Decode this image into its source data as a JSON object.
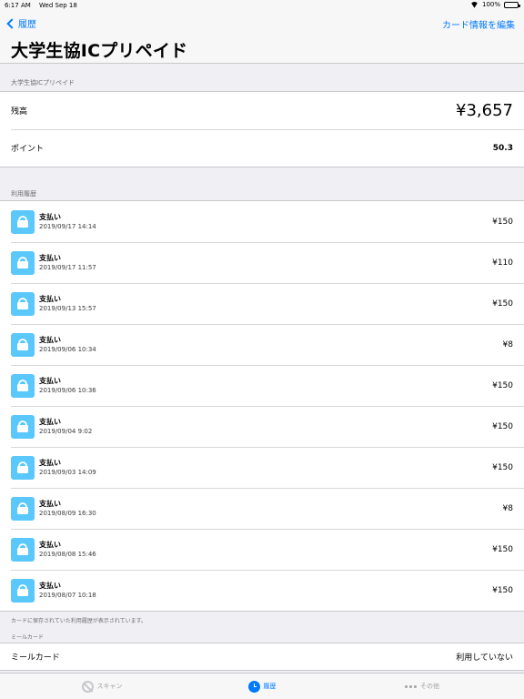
{
  "status_bar": {
    "time": "6:17 AM",
    "date": "Wed Sep 18",
    "battery": "100%"
  },
  "nav": {
    "back_label": "履歴",
    "edit_label": "カード情報を編集",
    "title": "大学生協ICプリペイド"
  },
  "card_section": {
    "header": "大学生協ICプリペイド",
    "balance_label": "残高",
    "balance_value": "¥3,657",
    "points_label": "ポイント",
    "points_value": "50.3"
  },
  "history": {
    "header": "利用履歴",
    "items": [
      {
        "title": "支払い",
        "date": "2019/09/17 14:14",
        "amount": "¥150"
      },
      {
        "title": "支払い",
        "date": "2019/09/17 11:57",
        "amount": "¥110"
      },
      {
        "title": "支払い",
        "date": "2019/09/13 15:57",
        "amount": "¥150"
      },
      {
        "title": "支払い",
        "date": "2019/09/06 10:34",
        "amount": "¥8"
      },
      {
        "title": "支払い",
        "date": "2019/09/06 10:36",
        "amount": "¥150"
      },
      {
        "title": "支払い",
        "date": "2019/09/04 9:02",
        "amount": "¥150"
      },
      {
        "title": "支払い",
        "date": "2019/09/03 14:09",
        "amount": "¥150"
      },
      {
        "title": "支払い",
        "date": "2019/08/09 16:30",
        "amount": "¥8"
      },
      {
        "title": "支払い",
        "date": "2019/08/08 15:46",
        "amount": "¥150"
      },
      {
        "title": "支払い",
        "date": "2019/08/07 10:18",
        "amount": "¥150"
      }
    ],
    "footer": "カードに保存されていた利用履歴が表示されています。"
  },
  "meal_card": {
    "header": "ミールカード",
    "label": "ミールカード",
    "status": "利用していない"
  },
  "tab_bar": {
    "scan_label": "スキャン",
    "history_label": "履歴",
    "other_label": "その他"
  },
  "colors": {
    "accent": "#007aff",
    "icon_background": "#5ac8fa"
  }
}
